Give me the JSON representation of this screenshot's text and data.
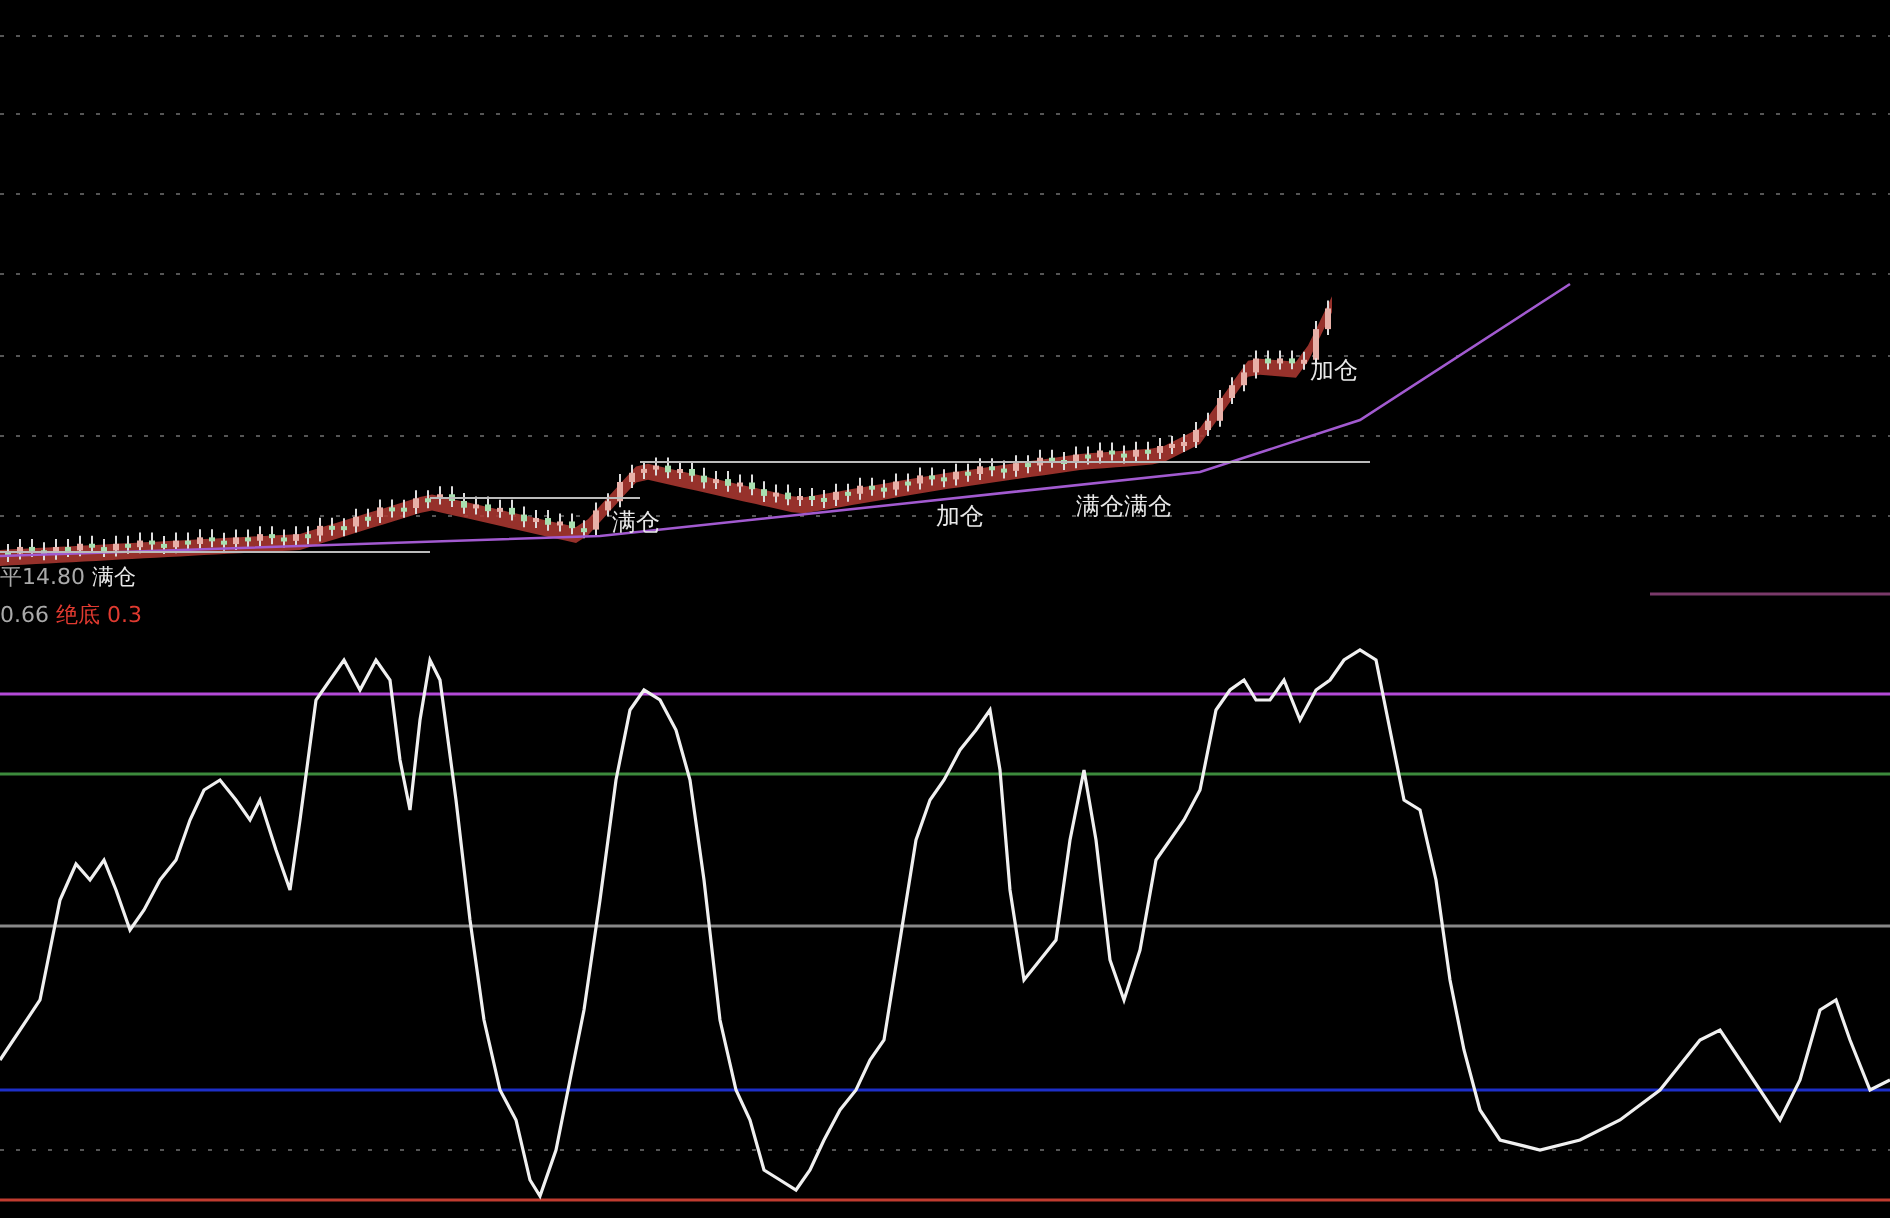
{
  "price_panel": {
    "signals": [
      {
        "text": "满仓"
      },
      {
        "text": "加仓"
      },
      {
        "text": "满仓满仓"
      },
      {
        "text": "加仓"
      }
    ],
    "readout_lines": [
      [
        {
          "text": "平14.80",
          "kind": "value"
        },
        {
          "text": "满仓",
          "kind": "signal"
        }
      ],
      [
        {
          "text": "0.66",
          "kind": "value"
        },
        {
          "text": "绝底",
          "kind": "alert"
        },
        {
          "text": "0.3",
          "kind": "alert"
        }
      ]
    ]
  }
}
